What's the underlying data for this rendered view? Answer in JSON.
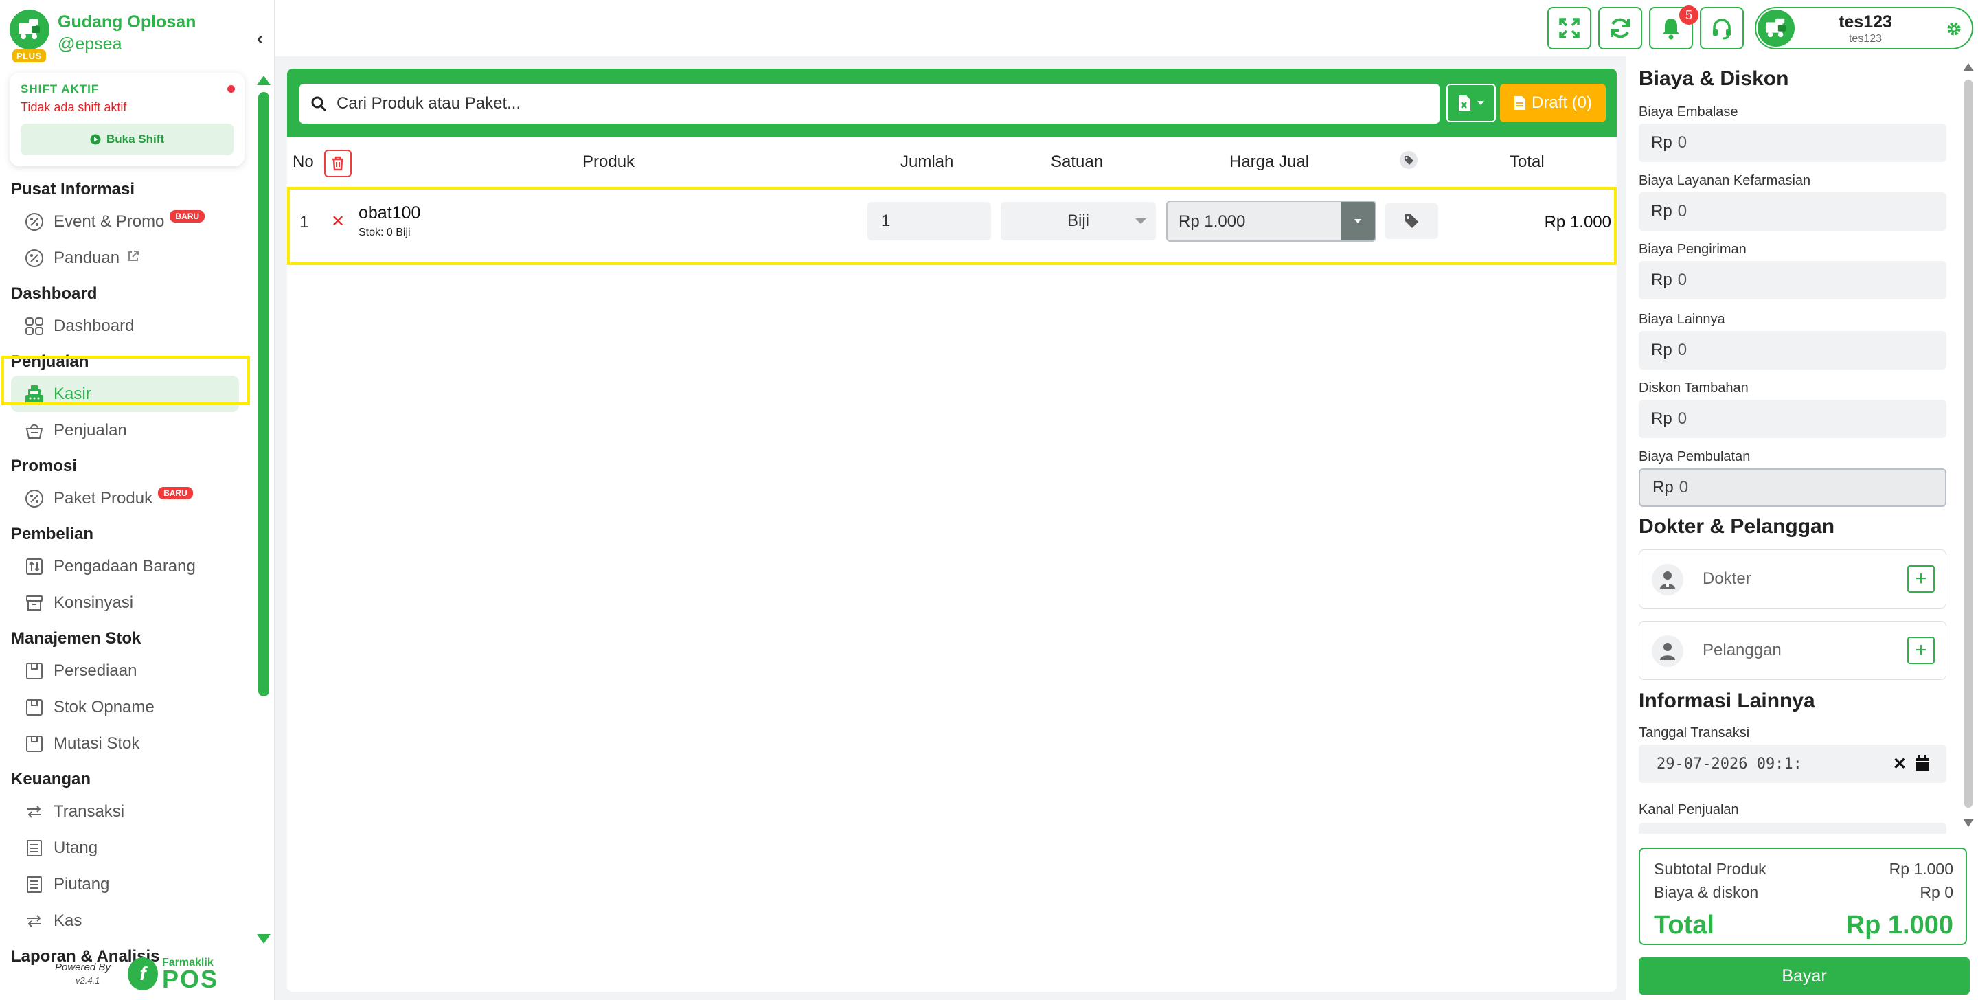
{
  "brand": {
    "name": "Gudang Oplosan",
    "handle": "@epsea",
    "badge": "PLUS"
  },
  "shift": {
    "title": "SHIFT AKTIF",
    "status": "Tidak ada shift aktif",
    "button": "Buka Shift"
  },
  "nav": {
    "sections": [
      {
        "title": "Pusat Informasi",
        "items": [
          {
            "label": "Event & Promo",
            "icon": "percent-icon",
            "badge": "BARU"
          },
          {
            "label": "Panduan",
            "icon": "percent-icon"
          }
        ]
      },
      {
        "title": "Dashboard",
        "items": [
          {
            "label": "Dashboard",
            "icon": "grid-icon"
          }
        ]
      },
      {
        "title": "Penjualan",
        "items": [
          {
            "label": "Kasir",
            "icon": "cash-register-icon",
            "active": true
          },
          {
            "label": "Penjualan",
            "icon": "basket-icon"
          }
        ]
      },
      {
        "title": "Promosi",
        "items": [
          {
            "label": "Paket Produk",
            "icon": "percent-icon",
            "badge": "BARU"
          }
        ]
      },
      {
        "title": "Pembelian",
        "items": [
          {
            "label": "Pengadaan Barang",
            "icon": "procurement-icon"
          },
          {
            "label": "Konsinyasi",
            "icon": "archive-icon"
          }
        ]
      },
      {
        "title": "Manajemen Stok",
        "items": [
          {
            "label": "Persediaan",
            "icon": "box-icon"
          },
          {
            "label": "Stok Opname",
            "icon": "box-icon"
          },
          {
            "label": "Mutasi Stok",
            "icon": "box-icon"
          }
        ]
      },
      {
        "title": "Keuangan",
        "items": [
          {
            "label": "Transaksi",
            "icon": "exchange-icon"
          },
          {
            "label": "Utang",
            "icon": "ledger-icon"
          },
          {
            "label": "Piutang",
            "icon": "ledger-icon"
          },
          {
            "label": "Kas",
            "icon": "exchange-icon"
          }
        ]
      },
      {
        "title": "Laporan & Analisis",
        "items": []
      }
    ]
  },
  "footer": {
    "powered": "Powered By",
    "version": "v2.4.1",
    "logo_top": "Farmaklik",
    "logo_bottom": "POS"
  },
  "topbar": {
    "notif_count": "5",
    "user_name": "tes123",
    "user_sub": "tes123"
  },
  "cart": {
    "search_placeholder": "Cari Produk atau Paket...",
    "draft_label": "Draft (0)",
    "headers": {
      "no": "No",
      "produk": "Produk",
      "jumlah": "Jumlah",
      "satuan": "Satuan",
      "harga": "Harga Jual",
      "total": "Total"
    },
    "items": [
      {
        "no": "1",
        "name": "obat100",
        "stok": "Stok: 0 Biji",
        "qty": "1",
        "unit": "Biji",
        "price": "Rp 1.000",
        "total": "Rp 1.000"
      }
    ]
  },
  "biaya": {
    "title": "Biaya & Diskon",
    "currency": "Rp",
    "fields": [
      {
        "label": "Biaya Embalase",
        "value": "0"
      },
      {
        "label": "Biaya Layanan Kefarmasian",
        "value": "0"
      },
      {
        "label": "Biaya Pengiriman",
        "value": "0"
      },
      {
        "label": "Biaya Lainnya",
        "value": "0"
      },
      {
        "label": "Diskon Tambahan",
        "value": "0"
      },
      {
        "label": "Biaya Pembulatan",
        "value": "0"
      }
    ]
  },
  "dokter": {
    "title": "Dokter & Pelanggan",
    "dokter_label": "Dokter",
    "pelanggan_label": "Pelanggan"
  },
  "info": {
    "title": "Informasi Lainnya",
    "tanggal_label": "Tanggal Transaksi",
    "tanggal_value": "29-07-2026 09:1:",
    "kanal_label": "Kanal Penjualan"
  },
  "summary": {
    "subtotal_label": "Subtotal Produk",
    "subtotal_value": "Rp 1.000",
    "biaya_label": "Biaya & diskon",
    "biaya_value": "Rp 0",
    "total_label": "Total",
    "total_value": "Rp 1.000",
    "pay_label": "Bayar"
  },
  "colors": {
    "accent": "#2db34a",
    "highlight": "#ffeb00",
    "danger": "#ef3b3b"
  }
}
